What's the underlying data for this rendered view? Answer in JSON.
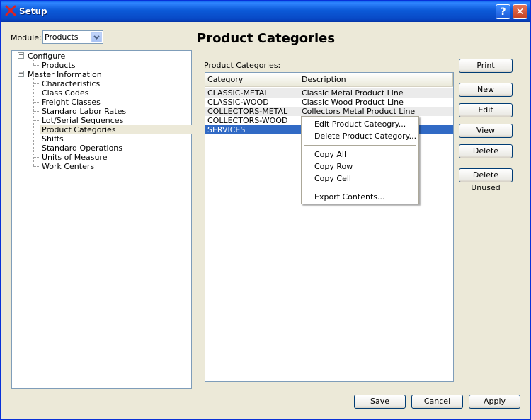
{
  "window": {
    "title": "Setup",
    "help_label": "?",
    "close_label": "✕"
  },
  "module": {
    "label": "Module:",
    "value": "Products"
  },
  "tree": {
    "groups": [
      {
        "label": "Configure",
        "expander": "−",
        "children": [
          "Products"
        ]
      },
      {
        "label": "Master Information",
        "expander": "−",
        "children": [
          "Characteristics",
          "Class Codes",
          "Freight Classes",
          "Standard Labor Rates",
          "Lot/Serial Sequences",
          "Product Categories",
          "Shifts",
          "Standard Operations",
          "Units of Measure",
          "Work Centers"
        ]
      }
    ],
    "selected": "Product Categories"
  },
  "page": {
    "heading": "Product Categories",
    "list_label": "Product Categories:"
  },
  "table": {
    "columns": [
      "Category",
      "Description"
    ],
    "rows": [
      {
        "category": "CLASSIC-METAL",
        "description": "Classic Metal Product Line"
      },
      {
        "category": "CLASSIC-WOOD",
        "description": "Classic Wood Product Line"
      },
      {
        "category": "COLLECTORS-METAL",
        "description": "Collectors Metal Product Line"
      },
      {
        "category": "COLLECTORS-WOOD",
        "description": ""
      },
      {
        "category": "SERVICES",
        "description": ""
      }
    ],
    "selected_index": 4
  },
  "context_menu": {
    "items": [
      "Edit Product Cateogry...",
      "Delete Product Category...",
      "Copy All",
      "Copy Row",
      "Copy Cell",
      "Export Contents..."
    ]
  },
  "side_buttons": {
    "print": "Print",
    "new": "New",
    "edit": "Edit",
    "view": "View",
    "delete": "Delete",
    "delete_unused": "Delete Unused"
  },
  "footer_buttons": {
    "save": "Save",
    "cancel": "Cancel",
    "apply": "Apply"
  },
  "colors": {
    "title_bar": "#0c5ad8",
    "selection": "#316ac5",
    "window_bg": "#ece9d8"
  }
}
